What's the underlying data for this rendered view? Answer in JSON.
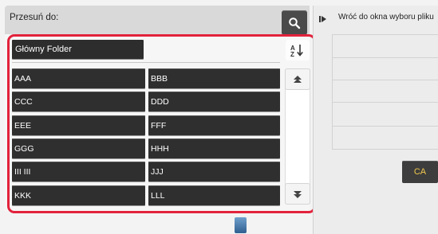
{
  "header": {
    "label": "Przesuń do:",
    "search_icon": "search-icon"
  },
  "folder": {
    "path": "Główny Folder",
    "sort_icon": "sort-az-icon"
  },
  "list": {
    "items": [
      "AAA",
      "BBB",
      "CCC",
      "DDD",
      "EEE",
      "FFF",
      "GGG",
      "HHH",
      "III III",
      "JJJ",
      "KKK",
      "LLL"
    ]
  },
  "scroll": {
    "up_icon": "scroll-up-icon",
    "down_icon": "scroll-down-icon"
  },
  "side": {
    "back_label": "Wróć do okna wyboru pliku",
    "back_icon": "play-arrow-icon",
    "ca_label": "CA"
  },
  "colors": {
    "highlight_frame": "#e2223c",
    "item_bg": "#2f2f2f",
    "ca_text": "#f2c94c"
  }
}
